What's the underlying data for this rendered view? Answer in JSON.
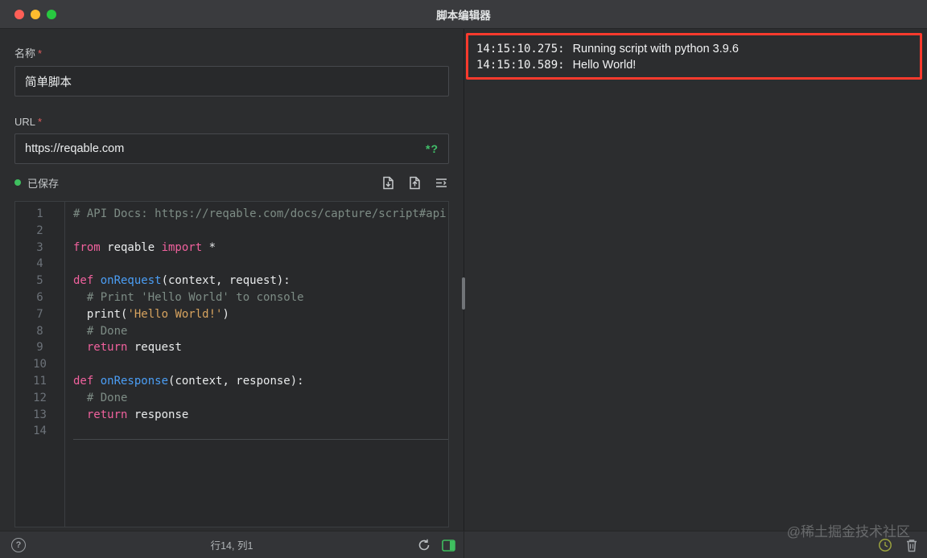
{
  "window": {
    "title": "脚本编辑器"
  },
  "form": {
    "name_label": "名称",
    "required_mark": "*",
    "name_value": "简单脚本",
    "url_label": "URL",
    "url_value": "https://reqable.com",
    "url_hint": "*?"
  },
  "toolbar": {
    "saved_status": "已保存",
    "icons": [
      "open-script-file-icon",
      "export-script-file-icon",
      "format-code-icon"
    ]
  },
  "editor": {
    "lines": [
      {
        "n": "1",
        "tokens": [
          [
            "# API Docs: https://reqable.com/docs/capture/script#api",
            "comment"
          ]
        ]
      },
      {
        "n": "2",
        "tokens": []
      },
      {
        "n": "3",
        "tokens": [
          [
            "from",
            "kw"
          ],
          [
            " reqable ",
            "plain"
          ],
          [
            "import",
            "kw"
          ],
          [
            " *",
            "plain"
          ]
        ]
      },
      {
        "n": "4",
        "tokens": []
      },
      {
        "n": "5",
        "tokens": [
          [
            "def ",
            "kw"
          ],
          [
            "onRequest",
            "fn"
          ],
          [
            "(context, request):",
            "plain"
          ]
        ]
      },
      {
        "n": "6",
        "tokens": [
          [
            "  # Print 'Hello World' to console",
            "comment"
          ]
        ]
      },
      {
        "n": "7",
        "tokens": [
          [
            "  print(",
            "plain"
          ],
          [
            "'Hello World!'",
            "str"
          ],
          [
            ")",
            "plain"
          ]
        ]
      },
      {
        "n": "8",
        "tokens": [
          [
            "  # Done",
            "comment"
          ]
        ]
      },
      {
        "n": "9",
        "tokens": [
          [
            "  return",
            "kw"
          ],
          [
            " request",
            "plain"
          ]
        ]
      },
      {
        "n": "10",
        "tokens": []
      },
      {
        "n": "11",
        "tokens": [
          [
            "def ",
            "kw"
          ],
          [
            "onResponse",
            "fn"
          ],
          [
            "(context, response):",
            "plain"
          ]
        ]
      },
      {
        "n": "12",
        "tokens": [
          [
            "  # Done",
            "comment"
          ]
        ]
      },
      {
        "n": "13",
        "tokens": [
          [
            "  return",
            "kw"
          ],
          [
            " response",
            "plain"
          ]
        ]
      },
      {
        "n": "14",
        "tokens": [],
        "current": true
      }
    ]
  },
  "statusbar": {
    "cursor_position": "行14, 列1"
  },
  "console": {
    "entries": [
      {
        "time": "14:15:10.275:",
        "message": "Running script with python 3.9.6"
      },
      {
        "time": "14:15:10.589:",
        "message": "Hello World!"
      }
    ]
  },
  "watermark": "@稀土掘金技术社区",
  "colors": {
    "keyword": "#f0619d",
    "function": "#4b9ef5",
    "string": "#d7a35f",
    "comment": "#7d8c85",
    "accent_green": "#3fbf5f",
    "console_border": "#fb3a2d",
    "required_red": "#e25d5d"
  }
}
